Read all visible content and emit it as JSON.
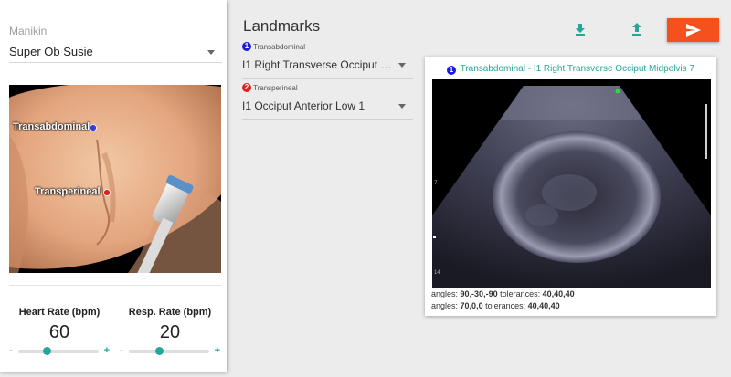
{
  "manikin": {
    "label": "Manikin",
    "selected": "Super Ob Susie",
    "landmark_labels": {
      "transabdominal": "Transabdominal",
      "transperineal": "Transperineal"
    }
  },
  "vitals": {
    "heart_rate": {
      "label": "Heart Rate (bpm)",
      "value": "60",
      "minus": "-",
      "plus": "+",
      "slider_fraction": 0.35
    },
    "resp_rate": {
      "label": "Resp. Rate (bpm)",
      "value": "20",
      "minus": "-",
      "plus": "+",
      "slider_fraction": 0.38
    }
  },
  "landmarks": {
    "title": "Landmarks",
    "items": [
      {
        "badge": "1",
        "badge_color": "#1a1adc",
        "caption": "Transabdominal",
        "value": "I1 Right Transverse Occiput Midpelvis 7"
      },
      {
        "badge": "2",
        "badge_color": "#e02020",
        "caption": "Transperineal",
        "value": "I1 Occiput Anterior Low 1"
      }
    ]
  },
  "toolbar": {
    "download_icon": "download-icon",
    "upload_icon": "upload-icon",
    "send_icon": "send-icon",
    "accent": "#26a69a",
    "send_color": "#f4511e"
  },
  "ultrasound": {
    "badge": "1",
    "title": "Transabdominal - I1 Right Transverse Occiput Midpelvis 7",
    "depth_labels": [
      "7",
      "14"
    ],
    "line1_label": "angles:",
    "line1_angles": "90,-30,-90",
    "line1_tol_label": "tolerances:",
    "line1_tol": "40,40,40",
    "line2_label": "angles:",
    "line2_angles": "70,0,0",
    "line2_tol_label": "tolerances:",
    "line2_tol": "40,40,40"
  }
}
